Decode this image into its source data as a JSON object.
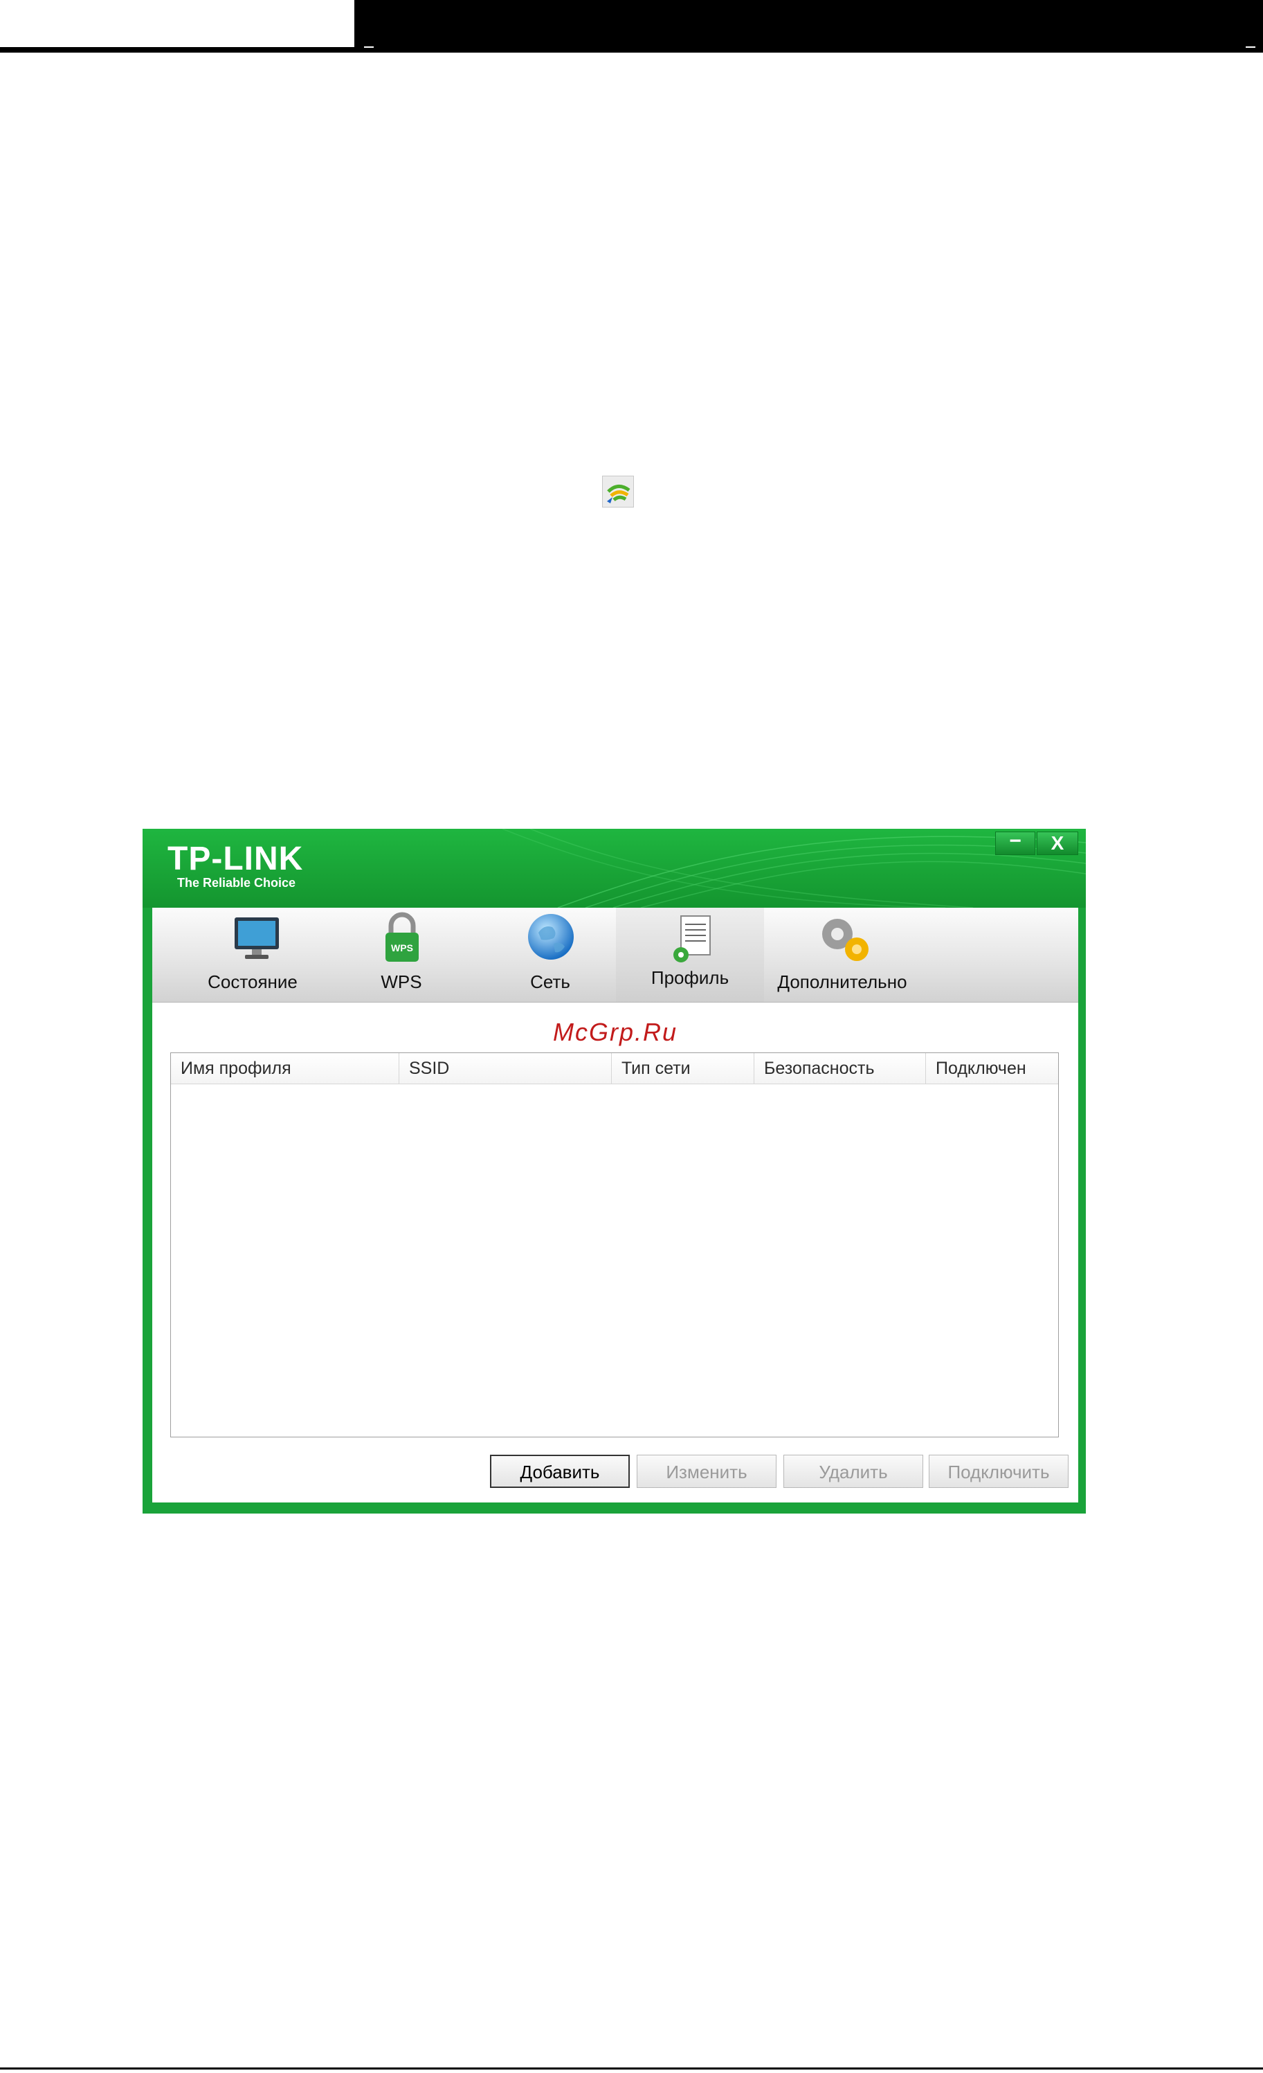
{
  "app": {
    "logo": "TP-LINK",
    "tagline": "The Reliable Choice",
    "minimize_label": "−",
    "close_label": "X",
    "watermark": "McGrp.Ru"
  },
  "tabs": [
    {
      "label": "Состояние",
      "icon": "monitor-icon"
    },
    {
      "label": "WPS",
      "icon": "lock-icon",
      "icon_text": "WPS"
    },
    {
      "label": "Сеть",
      "icon": "globe-icon"
    },
    {
      "label": "Профиль",
      "icon": "profile-document-icon",
      "active": true
    },
    {
      "label": "Дополнительно",
      "icon": "gears-icon"
    }
  ],
  "table": {
    "columns": [
      "Имя профиля",
      "SSID",
      "Тип сети",
      "Безопасность",
      "Подключен"
    ],
    "rows": []
  },
  "buttons": {
    "add": "Добавить",
    "edit": "Изменить",
    "delete": "Удалить",
    "connect": "Подключить"
  },
  "colors": {
    "brand_green": "#1aa33a",
    "watermark_red": "#c21b1b"
  }
}
